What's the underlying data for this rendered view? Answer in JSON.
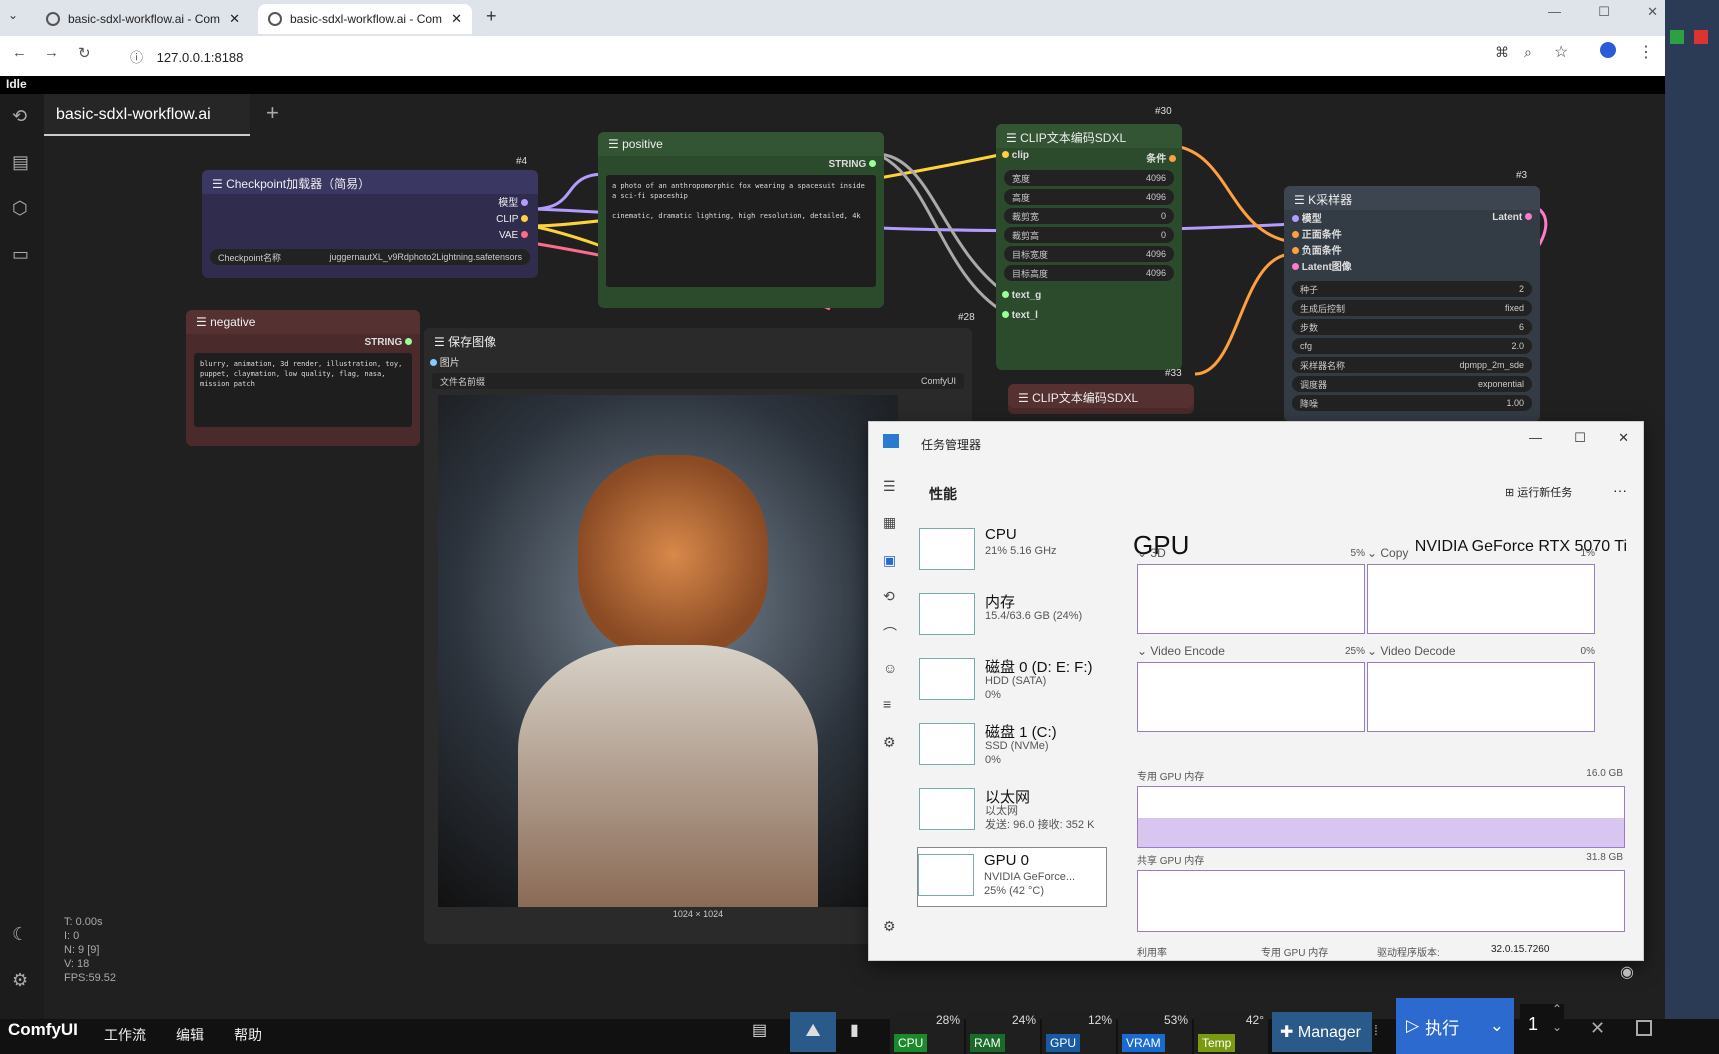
{
  "browser": {
    "tabs": [
      {
        "title": "basic-sdxl-workflow.ai - Com",
        "close": "✕"
      },
      {
        "title": "basic-sdxl-workflow.ai - Com",
        "close": "✕"
      }
    ],
    "new_tab": "+",
    "url": "127.0.0.1:8188",
    "window_controls": [
      "—",
      "☐",
      "✕"
    ]
  },
  "status": {
    "text": "Idle"
  },
  "workflow_tab": {
    "title": "basic-sdxl-workflow.ai",
    "add": "+"
  },
  "nodes": {
    "checkpoint": {
      "id": "#4",
      "title": "Checkpoint加载器（简易）",
      "outputs": [
        "模型",
        "CLIP",
        "VAE"
      ],
      "widget_label": "Checkpoint名称",
      "widget_value": "juggernautXL_v9Rdphoto2Lightning.safetensors"
    },
    "positive": {
      "title": "positive",
      "output": "STRING",
      "text": "a photo of an anthropomorphic fox wearing a spacesuit inside a sci-fi spaceship\n\ncinematic, dramatic lighting, high resolution, detailed, 4k"
    },
    "negative": {
      "title": "negative",
      "output": "STRING",
      "text": "blurry, animation, 3d render, illustration, toy, puppet, claymation, low quality, flag, nasa, mission patch"
    },
    "save_image": {
      "title": "保存图像",
      "input": "图片",
      "widget_label": "文件名前缀",
      "widget_value": "ComfyUI",
      "image_size": "1024 × 1024"
    },
    "clip_sdxl": {
      "id": "#30",
      "second_id": "#28",
      "title": "CLIP文本编码SDXL",
      "input": "clip",
      "output": "条件",
      "widgets": [
        {
          "label": "宽度",
          "value": "4096"
        },
        {
          "label": "高度",
          "value": "4096"
        },
        {
          "label": "裁剪宽",
          "value": "0"
        },
        {
          "label": "裁剪高",
          "value": "0"
        },
        {
          "label": "目标宽度",
          "value": "4096"
        },
        {
          "label": "目标高度",
          "value": "4096"
        }
      ],
      "text_inputs": [
        "text_g",
        "text_l"
      ]
    },
    "clip_sdxl_2": {
      "id": "#33",
      "title": "CLIP文本编码SDXL"
    },
    "ksampler": {
      "id": "#3",
      "title": "K采样器",
      "inputs": [
        "模型",
        "正面条件",
        "负面条件",
        "Latent图像"
      ],
      "output": "Latent",
      "widgets": [
        {
          "label": "种子",
          "value": "2"
        },
        {
          "label": "生成后控制",
          "value": "fixed"
        },
        {
          "label": "步数",
          "value": "6"
        },
        {
          "label": "cfg",
          "value": "2.0"
        },
        {
          "label": "采样器名称",
          "value": "dpmpp_2m_sde"
        },
        {
          "label": "调度器",
          "value": "exponential"
        },
        {
          "label": "降噪",
          "value": "1.00"
        }
      ]
    }
  },
  "stats": {
    "t": "T: 0.00s",
    "i": "I: 0",
    "n": "N: 9 [9]",
    "v": "V: 18",
    "fps": "FPS:59.52"
  },
  "task_manager": {
    "title": "任务管理器",
    "section": "性能",
    "run_new_task": "运行新任务",
    "more": "···",
    "items": [
      {
        "name": "CPU",
        "detail": "21% 5.16 GHz"
      },
      {
        "name": "内存",
        "detail": "15.4/63.6 GB (24%)"
      },
      {
        "name": "磁盘 0 (D: E: F:)",
        "detail": "HDD (SATA)",
        "detail2": "0%"
      },
      {
        "name": "磁盘 1 (C:)",
        "detail": "SSD (NVMe)",
        "detail2": "0%"
      },
      {
        "name": "以太网",
        "detail": "以太网",
        "detail2": "发送: 96.0  接收: 352 K"
      },
      {
        "name": "GPU 0",
        "detail": "NVIDIA GeForce...",
        "detail2": "25% (42 °C)"
      }
    ],
    "gpu": {
      "heading": "GPU",
      "model": "NVIDIA GeForce RTX 5070 Ti",
      "engines": [
        {
          "name": "3D",
          "pct": "5%"
        },
        {
          "name": "Copy",
          "pct": "1%"
        },
        {
          "name": "Video Encode",
          "pct": "25%"
        },
        {
          "name": "Video Decode",
          "pct": "0%"
        }
      ],
      "dedicated_label": "专用 GPU 内存",
      "dedicated_max": "16.0 GB",
      "shared_label": "共享 GPU 内存",
      "shared_max": "31.8 GB",
      "footer": [
        "利用率",
        "专用 GPU 内存",
        "驱动程序版本:",
        "32.0.15.7260"
      ]
    }
  },
  "taskbar": {
    "brand": "ComfyUI",
    "menus": [
      "工作流",
      "编辑",
      "帮助"
    ],
    "meters": [
      {
        "tag": "CPU",
        "pct": "28%",
        "color": "#1a8a2a"
      },
      {
        "tag": "RAM",
        "pct": "24%",
        "color": "#1a6a2a"
      },
      {
        "tag": "GPU",
        "pct": "12%",
        "color": "#1a5aa0"
      },
      {
        "tag": "VRAM",
        "pct": "53%",
        "color": "#1a6ad0"
      },
      {
        "tag": "Temp",
        "pct": "42°",
        "color": "#7a9a10"
      }
    ],
    "manager": "Manager",
    "run": "执行",
    "queue_count": "1"
  }
}
